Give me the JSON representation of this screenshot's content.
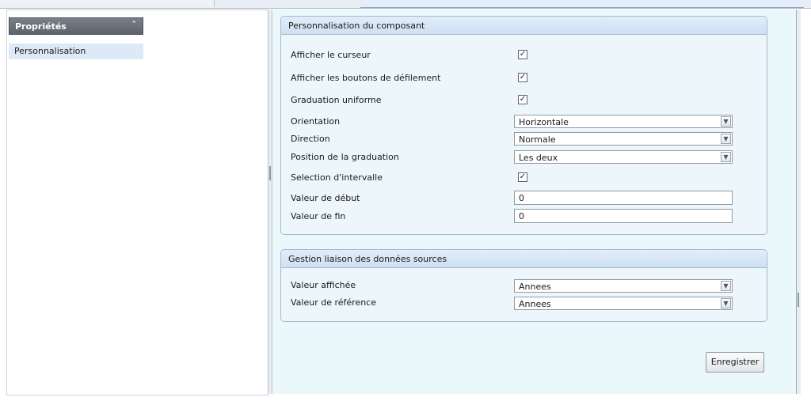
{
  "sidebar": {
    "header": "Propriétés",
    "items": [
      {
        "label": "Personnalisation"
      }
    ]
  },
  "group1": {
    "title": "Personnalisation du composant",
    "rows": {
      "show_cursor": {
        "label": "Afficher le curseur",
        "checked": true,
        "mark": "✓"
      },
      "show_scroll_buttons": {
        "label": "Afficher les boutons de défilement",
        "checked": true,
        "mark": "✓"
      },
      "uniform_graduation": {
        "label": "Graduation uniforme",
        "checked": true,
        "mark": "✓"
      },
      "orientation": {
        "label": "Orientation",
        "value": "Horizontale"
      },
      "direction": {
        "label": "Direction",
        "value": "Normale"
      },
      "graduation_position": {
        "label": "Position de la graduation",
        "value": "Les deux"
      },
      "interval_selection": {
        "label": "Selection d'intervalle",
        "checked": true,
        "mark": "✓"
      },
      "start_value": {
        "label": "Valeur de début",
        "value": "0"
      },
      "end_value": {
        "label": "Valeur de fin",
        "value": "0"
      }
    }
  },
  "group2": {
    "title": "Gestion liaison des données sources",
    "rows": {
      "displayed_value": {
        "label": "Valeur affichée",
        "value": "Annees"
      },
      "reference_value": {
        "label": "Valeur de référence",
        "value": "Annees"
      }
    }
  },
  "actions": {
    "save_label": "Enregistrer"
  },
  "colors": {
    "panel_background": "#eaf7fb",
    "group_header": "#d6e5f5",
    "sidebar_header": "#6b7179",
    "sidebar_item_selected": "#dde9f7"
  }
}
